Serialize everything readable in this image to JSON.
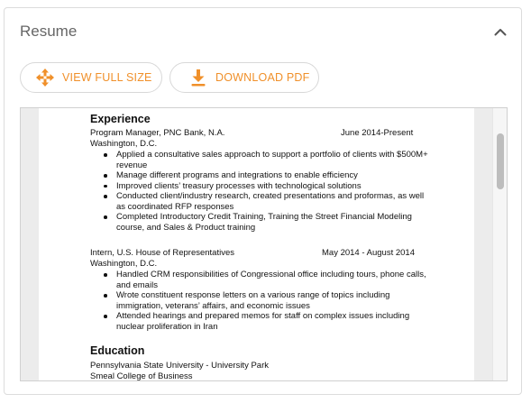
{
  "panel": {
    "title": "Resume",
    "view_full_size_label": "VIEW FULL SIZE",
    "download_pdf_label": "DOWNLOAD PDF",
    "accent_color": "#f0902a"
  },
  "resume": {
    "experience_heading": "Experience",
    "job1": {
      "title": "Program Manager, PNC Bank, N.A.",
      "dates": "June 2014-Present",
      "location": "Washington, D.C.",
      "bullets": [
        "Applied a consultative sales approach to support a portfolio of clients with $500M+ revenue",
        "Manage different programs and integrations to enable efficiency",
        "Improved clients’ treasury processes with technological solutions",
        "Conducted client/industry research, created presentations and proformas, as well as coordinated RFP responses",
        "Completed Introductory Credit Training, Training the Street Financial Modeling course, and Sales & Product training"
      ]
    },
    "job2": {
      "title": "Intern, U.S. House of Representatives",
      "dates": "May 2014 - August 2014",
      "location": "Washington, D.C.",
      "bullets": [
        "Handled CRM responsibilities of Congressional office including tours, phone calls, and emails",
        "Wrote constituent response letters on a various range of topics including immigration, veterans’ affairs, and economic issues",
        "Attended hearings and prepared memos for staff on complex issues including nuclear proliferation in Iran"
      ]
    },
    "education_heading": "Education",
    "school": "Pennsylvania State University - University Park",
    "college": "Smeal College of Business"
  }
}
